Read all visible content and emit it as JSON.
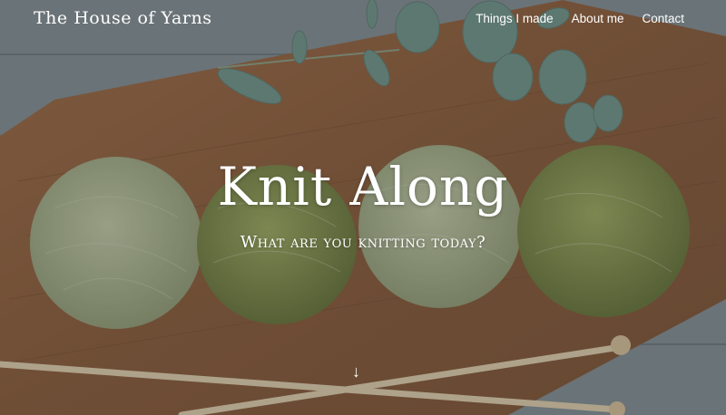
{
  "nav": {
    "brand": "The House of Yarns",
    "links": [
      "Things I made",
      "About me",
      "Contact"
    ]
  },
  "hero": {
    "title": "Knit Along",
    "subtitle": "What are you knitting today?",
    "scroll_icon": "arrow-down-icon",
    "scroll_glyph": "↓"
  },
  "colors": {
    "wood": "#8a5f3f",
    "yarn_light": "#a7b08d",
    "yarn_dark": "#7d8a4c",
    "eucalyptus": "#6f9086",
    "background_planks": "#7c878b"
  }
}
